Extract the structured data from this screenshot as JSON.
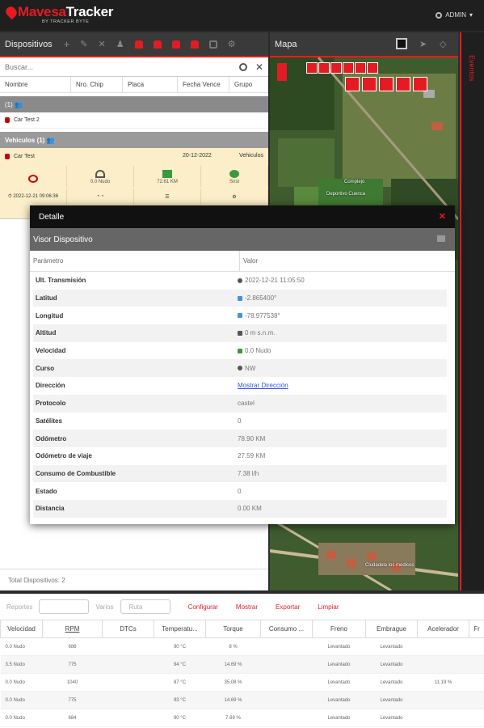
{
  "app": {
    "name_part1": "Mavesa",
    "name_part2": "Tracker",
    "subtitle": "BY TRACKER BYTE",
    "user": "ADMIN"
  },
  "devices": {
    "title": "Dispositivos",
    "search_placeholder": "Buscar...",
    "columns": [
      "Nombre",
      "Nro. Chip",
      "Placa",
      "Fecha Vence",
      "Grupo"
    ],
    "group1_label": "(1)",
    "group1_item": "Car Test 2",
    "group2_label": "Vehiculos (1)",
    "group2_item": "Car Test",
    "group2_date": "20-12-2022",
    "group2_group": "Vehiculos",
    "tile_speed": "0.0 Nudo",
    "tile_odometer": "72.61 KM",
    "tile_status": "Snst",
    "tile_datetime": "2022-12-21 09:06:36",
    "total": "Total Dispositivos: 2"
  },
  "map": {
    "title": "Mapa",
    "label_stadium": "Deportivo Cuenca",
    "label_stadium2": "Complejo",
    "label_town": "Ciudadela los medicos"
  },
  "events_tab": "Eventos",
  "detail": {
    "title": "Detalle",
    "subtitle": "Visor Dispositivo",
    "col_param": "Parámetro",
    "col_value": "Valor",
    "rows": [
      {
        "param": "Ult. Transmisión",
        "value": "2022-12-21 11:05:50",
        "icon": "clock-icon"
      },
      {
        "param": "Latitud",
        "value": "-2.865400°",
        "icon": "location-arrow-icon"
      },
      {
        "param": "Longitud",
        "value": "-78.977538°",
        "icon": "location-arrow-icon"
      },
      {
        "param": "Altitud",
        "value": "0 m s.n.m.",
        "icon": "altitude-icon"
      },
      {
        "param": "Velocidad",
        "value": "0.0 Nudo",
        "icon": "speed-icon"
      },
      {
        "param": "Curso",
        "value": "NW",
        "icon": "compass-icon"
      },
      {
        "param": "Dirección",
        "value": "Mostrar Dirección",
        "icon": "link"
      },
      {
        "param": "Protocolo",
        "value": "castel",
        "icon": ""
      },
      {
        "param": "Satélites",
        "value": "0",
        "icon": ""
      },
      {
        "param": "Odómetro",
        "value": "78.90 KM",
        "icon": ""
      },
      {
        "param": "Odómetro de viaje",
        "value": "27.59 KM",
        "icon": ""
      },
      {
        "param": "Consumo de Combustible",
        "value": "7.38 l/h",
        "icon": ""
      },
      {
        "param": "Estado",
        "value": "0",
        "icon": ""
      },
      {
        "param": "Distancia",
        "value": "0.00 KM",
        "icon": ""
      }
    ]
  },
  "reports": {
    "label_reportes": "Reportes",
    "label_varios": "Varios",
    "select_ruta": "Ruta",
    "configurar": "Configurar",
    "mostrar": "Mostrar",
    "exportar": "Exportar",
    "limpiar": "Limpiar",
    "columns": [
      "Velocidad",
      "RPM",
      "DTCs",
      "Temperatu...",
      "Torque",
      "Consumo ...",
      "Freno",
      "Embrague",
      "Acelerador",
      "Fr"
    ],
    "rows": [
      [
        "0.0 Nudo",
        "686",
        "",
        "90 °C",
        "8 %",
        "",
        "Levantado",
        "Levantado",
        "",
        ""
      ],
      [
        "3.5 Nudo",
        "775",
        "",
        "94 °C",
        "14.69 %",
        "",
        "Levantado",
        "Levantado",
        "",
        ""
      ],
      [
        "0.0 Nudo",
        "1040",
        "",
        "87 °C",
        "35.08 %",
        "",
        "Levantado",
        "Levantado",
        "11.19 %",
        ""
      ],
      [
        "0.0 Nudo",
        "775",
        "",
        "93 °C",
        "14.69 %",
        "",
        "Levantado",
        "Levantado",
        "",
        ""
      ],
      [
        "0.0 Nudo",
        "684",
        "",
        "90 °C",
        "7.69 %",
        "",
        "Levantado",
        "Levantado",
        "",
        ""
      ]
    ]
  }
}
